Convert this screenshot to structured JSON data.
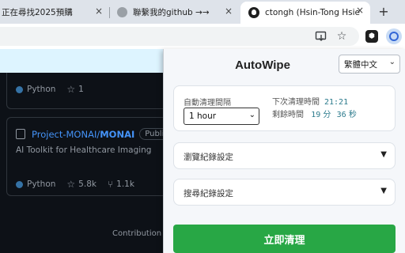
{
  "browser": {
    "tabs": [
      {
        "title": "正在尋找2025預購",
        "close": "×"
      },
      {
        "title": "聯繫我的github →→",
        "close": "×"
      },
      {
        "title": "ctongh (Hsin-Tong Hsieh)",
        "close": "×"
      }
    ],
    "new_tab": "+",
    "toolbar_icons": [
      "install-icon",
      "star-icon",
      "extension-icon",
      "autowipe-extension-icon"
    ]
  },
  "github": {
    "top_card": {
      "language": "Python",
      "stars": "1"
    },
    "repo": {
      "owner": "Project-MONAI/",
      "name": "MONAI",
      "badge": "Public",
      "description": "AI Toolkit for Healthcare Imaging",
      "language": "Python",
      "stars": "5.8k",
      "forks": "1.1k"
    },
    "footer_text": "Contribution se"
  },
  "popup": {
    "title": "AutoWipe",
    "language_select": "繁體中文",
    "interval_label": "自動清理間隔",
    "interval_value": "1 hour",
    "next_clean_label": "下次清理時間",
    "next_clean_time": "21:21",
    "remaining_label": "剩餘時間",
    "remaining_minutes": "19",
    "minutes_unit": "分",
    "remaining_seconds": "36",
    "seconds_unit": "秒",
    "browse_section": "瀏覽紀錄設定",
    "search_section": "搜尋紀錄設定",
    "section_arrow": "▼",
    "clean_button": "立即清理"
  },
  "colors": {
    "clean_button": "#28a745",
    "github_bg": "#0d1117",
    "link_blue": "#4493f8",
    "python_dot": "#3572A5"
  }
}
